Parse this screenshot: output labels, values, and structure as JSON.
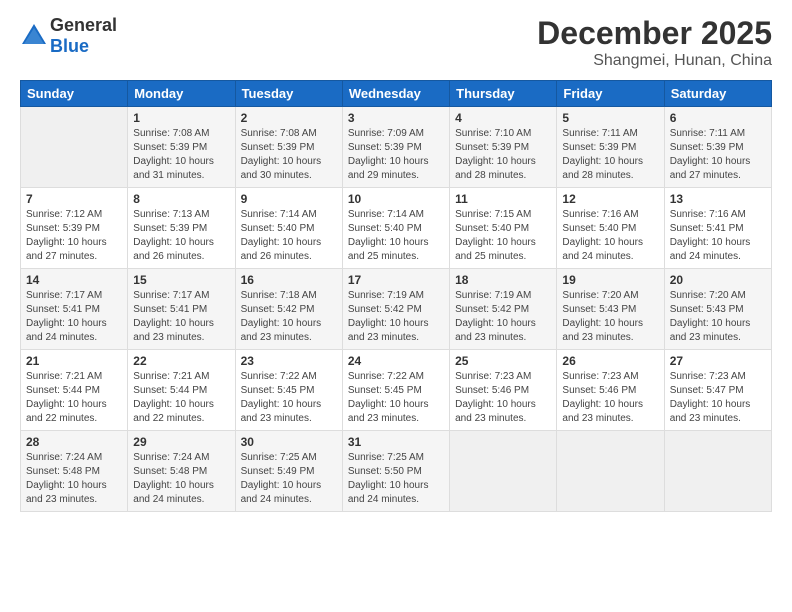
{
  "logo": {
    "general": "General",
    "blue": "Blue"
  },
  "header": {
    "month": "December 2025",
    "location": "Shangmei, Hunan, China"
  },
  "weekdays": [
    "Sunday",
    "Monday",
    "Tuesday",
    "Wednesday",
    "Thursday",
    "Friday",
    "Saturday"
  ],
  "weeks": [
    [
      {
        "day": "",
        "info": ""
      },
      {
        "day": "1",
        "info": "Sunrise: 7:08 AM\nSunset: 5:39 PM\nDaylight: 10 hours\nand 31 minutes."
      },
      {
        "day": "2",
        "info": "Sunrise: 7:08 AM\nSunset: 5:39 PM\nDaylight: 10 hours\nand 30 minutes."
      },
      {
        "day": "3",
        "info": "Sunrise: 7:09 AM\nSunset: 5:39 PM\nDaylight: 10 hours\nand 29 minutes."
      },
      {
        "day": "4",
        "info": "Sunrise: 7:10 AM\nSunset: 5:39 PM\nDaylight: 10 hours\nand 28 minutes."
      },
      {
        "day": "5",
        "info": "Sunrise: 7:11 AM\nSunset: 5:39 PM\nDaylight: 10 hours\nand 28 minutes."
      },
      {
        "day": "6",
        "info": "Sunrise: 7:11 AM\nSunset: 5:39 PM\nDaylight: 10 hours\nand 27 minutes."
      }
    ],
    [
      {
        "day": "7",
        "info": "Sunrise: 7:12 AM\nSunset: 5:39 PM\nDaylight: 10 hours\nand 27 minutes."
      },
      {
        "day": "8",
        "info": "Sunrise: 7:13 AM\nSunset: 5:39 PM\nDaylight: 10 hours\nand 26 minutes."
      },
      {
        "day": "9",
        "info": "Sunrise: 7:14 AM\nSunset: 5:40 PM\nDaylight: 10 hours\nand 26 minutes."
      },
      {
        "day": "10",
        "info": "Sunrise: 7:14 AM\nSunset: 5:40 PM\nDaylight: 10 hours\nand 25 minutes."
      },
      {
        "day": "11",
        "info": "Sunrise: 7:15 AM\nSunset: 5:40 PM\nDaylight: 10 hours\nand 25 minutes."
      },
      {
        "day": "12",
        "info": "Sunrise: 7:16 AM\nSunset: 5:40 PM\nDaylight: 10 hours\nand 24 minutes."
      },
      {
        "day": "13",
        "info": "Sunrise: 7:16 AM\nSunset: 5:41 PM\nDaylight: 10 hours\nand 24 minutes."
      }
    ],
    [
      {
        "day": "14",
        "info": "Sunrise: 7:17 AM\nSunset: 5:41 PM\nDaylight: 10 hours\nand 24 minutes."
      },
      {
        "day": "15",
        "info": "Sunrise: 7:17 AM\nSunset: 5:41 PM\nDaylight: 10 hours\nand 23 minutes."
      },
      {
        "day": "16",
        "info": "Sunrise: 7:18 AM\nSunset: 5:42 PM\nDaylight: 10 hours\nand 23 minutes."
      },
      {
        "day": "17",
        "info": "Sunrise: 7:19 AM\nSunset: 5:42 PM\nDaylight: 10 hours\nand 23 minutes."
      },
      {
        "day": "18",
        "info": "Sunrise: 7:19 AM\nSunset: 5:42 PM\nDaylight: 10 hours\nand 23 minutes."
      },
      {
        "day": "19",
        "info": "Sunrise: 7:20 AM\nSunset: 5:43 PM\nDaylight: 10 hours\nand 23 minutes."
      },
      {
        "day": "20",
        "info": "Sunrise: 7:20 AM\nSunset: 5:43 PM\nDaylight: 10 hours\nand 23 minutes."
      }
    ],
    [
      {
        "day": "21",
        "info": "Sunrise: 7:21 AM\nSunset: 5:44 PM\nDaylight: 10 hours\nand 22 minutes."
      },
      {
        "day": "22",
        "info": "Sunrise: 7:21 AM\nSunset: 5:44 PM\nDaylight: 10 hours\nand 22 minutes."
      },
      {
        "day": "23",
        "info": "Sunrise: 7:22 AM\nSunset: 5:45 PM\nDaylight: 10 hours\nand 23 minutes."
      },
      {
        "day": "24",
        "info": "Sunrise: 7:22 AM\nSunset: 5:45 PM\nDaylight: 10 hours\nand 23 minutes."
      },
      {
        "day": "25",
        "info": "Sunrise: 7:23 AM\nSunset: 5:46 PM\nDaylight: 10 hours\nand 23 minutes."
      },
      {
        "day": "26",
        "info": "Sunrise: 7:23 AM\nSunset: 5:46 PM\nDaylight: 10 hours\nand 23 minutes."
      },
      {
        "day": "27",
        "info": "Sunrise: 7:23 AM\nSunset: 5:47 PM\nDaylight: 10 hours\nand 23 minutes."
      }
    ],
    [
      {
        "day": "28",
        "info": "Sunrise: 7:24 AM\nSunset: 5:48 PM\nDaylight: 10 hours\nand 23 minutes."
      },
      {
        "day": "29",
        "info": "Sunrise: 7:24 AM\nSunset: 5:48 PM\nDaylight: 10 hours\nand 24 minutes."
      },
      {
        "day": "30",
        "info": "Sunrise: 7:25 AM\nSunset: 5:49 PM\nDaylight: 10 hours\nand 24 minutes."
      },
      {
        "day": "31",
        "info": "Sunrise: 7:25 AM\nSunset: 5:50 PM\nDaylight: 10 hours\nand 24 minutes."
      },
      {
        "day": "",
        "info": ""
      },
      {
        "day": "",
        "info": ""
      },
      {
        "day": "",
        "info": ""
      }
    ]
  ]
}
